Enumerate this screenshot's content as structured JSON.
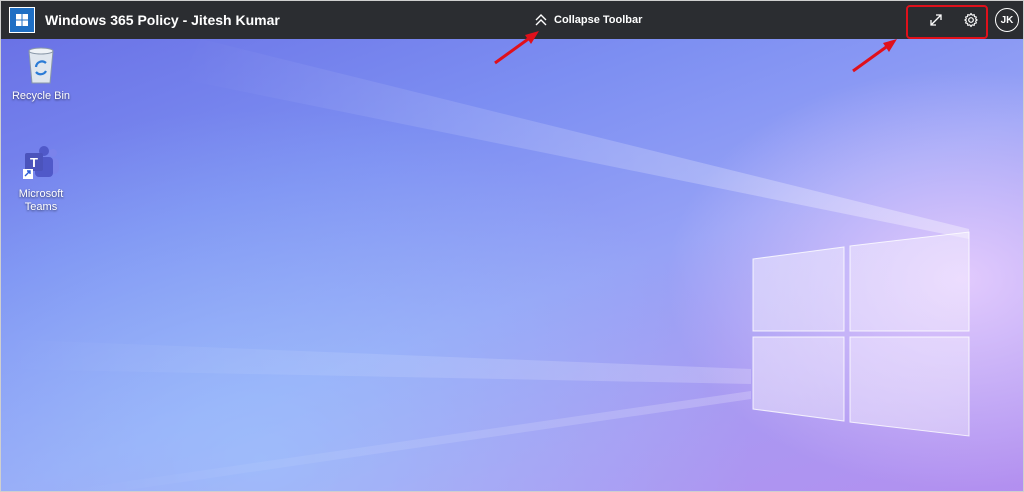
{
  "toolbar": {
    "app_icon": "windows-365-icon",
    "title": "Windows 365 Policy - Jitesh Kumar",
    "collapse_label": "Collapse Toolbar",
    "collapse_icon": "double-chevron-up-icon",
    "fullscreen_icon": "expand-diagonal-icon",
    "settings_icon": "gear-icon",
    "avatar_initials": "JK",
    "background_color": "#2b2d31",
    "highlight_color": "#e0101b"
  },
  "desktop": {
    "icons": [
      {
        "label": "Recycle Bin",
        "icon": "recycle-bin-icon"
      },
      {
        "label_line1": "Microsoft",
        "label_line2": "Teams",
        "icon": "microsoft-teams-icon"
      }
    ],
    "wallpaper": "windows-logo-light-beams"
  },
  "annotations": {
    "arrow_color": "#e0101b"
  }
}
